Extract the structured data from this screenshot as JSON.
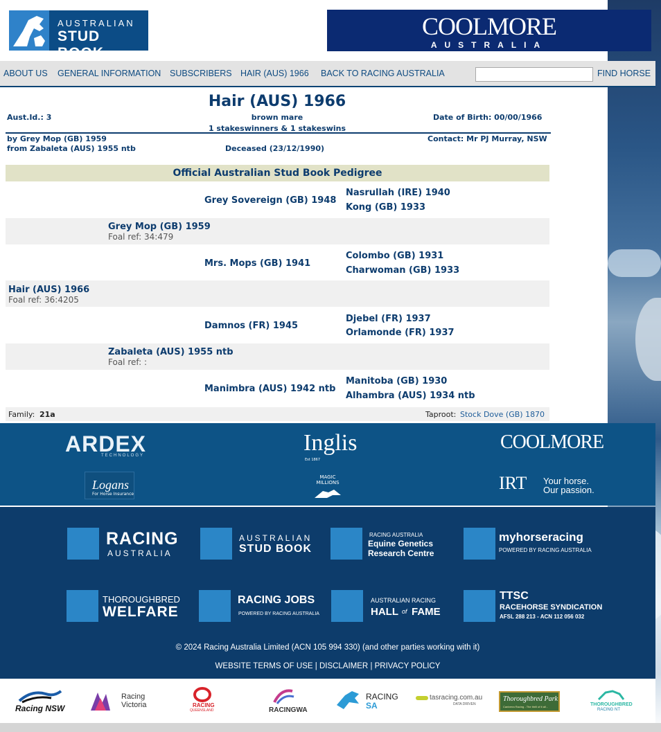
{
  "header": {
    "logo_line1": "AUSTRALIAN",
    "logo_line2": "STUD BOOK",
    "sponsor_name": "COOLMORE",
    "sponsor_sub": "AUSTRALIA"
  },
  "nav": {
    "items": [
      "ABOUT US",
      "GENERAL INFORMATION",
      "SUBSCRIBERS",
      "HAIR (AUS) 1966",
      "BACK TO RACING AUSTRALIA"
    ],
    "search_value": "",
    "find_label": "FIND HORSE"
  },
  "horse": {
    "title": "Hair (AUS) 1966",
    "aust_id": "Aust.Id.: 3",
    "color_sex": "brown mare",
    "stakes": "1 stakeswinners & 1 stakeswins",
    "dob": "Date of Birth: 00/00/1966",
    "sire_line": "by Grey Mop (GB) 1959",
    "dam_line": "from Zabaleta (AUS) 1955 ntb",
    "contact": "Contact: Mr PJ Murray, NSW",
    "deceased": "Deceased (23/12/1990)"
  },
  "pedigree": {
    "heading": "Official Australian Stud Book Pedigree",
    "subject": "Hair (AUS) 1966",
    "subject_foal": "Foal ref: 36:4205",
    "sire": "Grey Mop (GB) 1959",
    "sire_foal": "Foal ref: 34:479",
    "dam": "Zabaleta (AUS) 1955 ntb",
    "dam_foal": "Foal ref: :",
    "ss": "Grey Sovereign (GB) 1948",
    "sd": "Mrs. Mops (GB) 1941",
    "ds": "Damnos (FR) 1945",
    "dd": "Manimbra (AUS) 1942 ntb",
    "sss": "Nasrullah (IRE) 1940",
    "ssd": "Kong (GB) 1933",
    "sds": "Colombo (GB) 1931",
    "sdd": "Charwoman (GB) 1933",
    "dss": "Djebel (FR) 1937",
    "dsd": "Orlamonde (FR) 1937",
    "dds": "Manitoba (GB) 1930",
    "ddd": "Alhambra (AUS) 1934 ntb",
    "family_label": "Family:",
    "family_value": "21a",
    "taproot_label": "Taproot:",
    "taproot_value": "Stock Dove (GB) 1870"
  },
  "sponsors": {
    "ardex": "ARDEX",
    "ardex_sub": "TECHNOLOGY",
    "inglis": "Inglis",
    "inglis_sub": "Est 1867",
    "coolmore": "COOLMORE",
    "logans": "Logans",
    "logans_sub": "For Horse Insurance",
    "magic": "MAGIC MILLIONS",
    "irt": "IRT",
    "irt_tag1": "Your horse.",
    "irt_tag2": "Our passion."
  },
  "footer": {
    "racing_australia": [
      "RACING",
      "AUSTRALIA"
    ],
    "stud_book": [
      "AUSTRALIAN",
      "STUD BOOK"
    ],
    "equine": [
      "RACING AUSTRALIA",
      "Equine Genetics",
      "Research Centre"
    ],
    "myhorse": [
      "myhorseracing",
      "POWERED BY RACING AUSTRALIA"
    ],
    "welfare": [
      "THOROUGHBRED",
      "WELFARE"
    ],
    "jobs": [
      "RACING JOBS",
      "POWERED BY RACING AUSTRALIA"
    ],
    "hall": [
      "AUSTRALIAN RACING",
      "HALL",
      "of",
      "FAME"
    ],
    "ttsc": [
      "TTSC",
      "RACEHORSE SYNDICATION",
      "AFSL 288 213 - ACN 112 056 032"
    ],
    "copyright": "© 2024 Racing Australia Limited (ACN 105 994 330) (and other parties working with it)",
    "links": [
      "WEBSITE TERMS OF USE",
      "DISCLAIMER",
      "PRIVACY POLICY"
    ]
  },
  "states": {
    "nsw": "Racing NSW",
    "vic": [
      "Racing",
      "Victoria"
    ],
    "qld": [
      "RACING",
      "QUEENSLAND"
    ],
    "wa": "RACINGWA",
    "sa": [
      "RACING",
      "SA"
    ],
    "tas": "tasracing.com.au",
    "tas_sub": "DATA DRIVEN",
    "tpark": "Thoroughbred Park",
    "tpark_sub": "Canberra Racing - The thrill of it all -",
    "nt": [
      "THOROUGHBRED",
      "RACING NT"
    ]
  }
}
